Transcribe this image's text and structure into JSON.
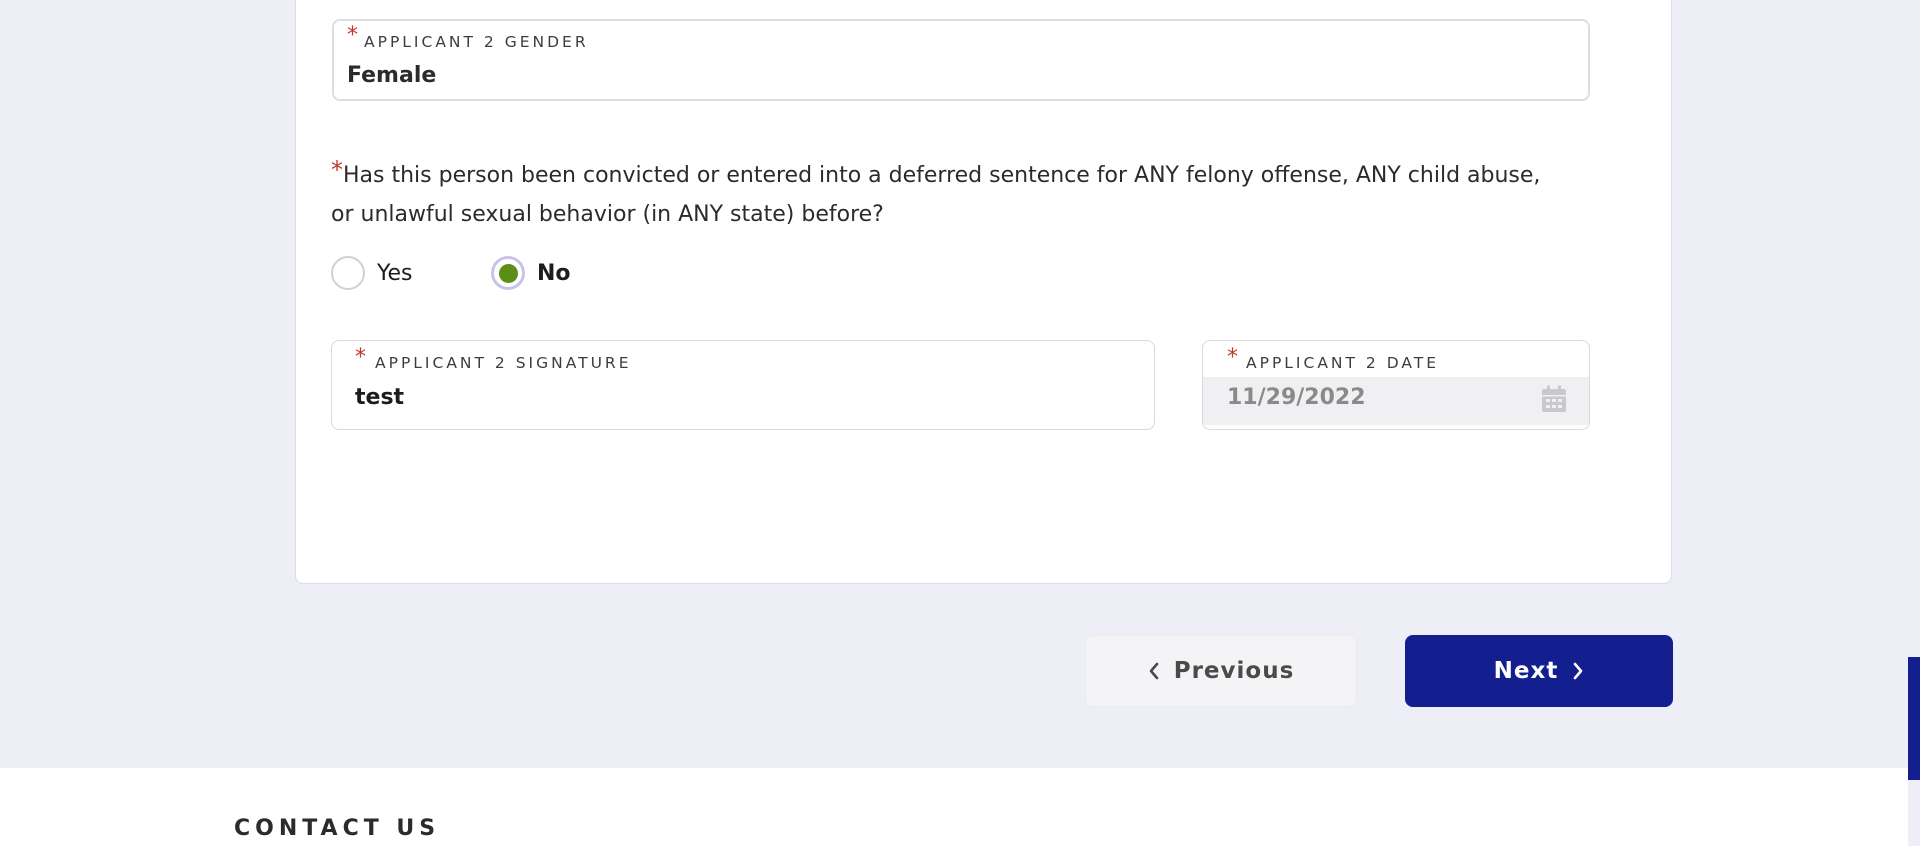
{
  "form": {
    "gender": {
      "label": "APPLICANT 2 GENDER",
      "value": "Female",
      "required_mark": "*"
    },
    "question": {
      "required_mark": "*",
      "line1": "Has this person been convicted or entered into a deferred sentence for ANY felony offense, ANY child abuse,",
      "line2": "or unlawful sexual behavior (in ANY state) before?",
      "options": [
        {
          "label": "Yes",
          "selected": false
        },
        {
          "label": "No",
          "selected": true
        }
      ],
      "selected_color": "#5c8e17"
    },
    "signature": {
      "label": "APPLICANT 2 SIGNATURE",
      "value": "test",
      "required_mark": "*"
    },
    "date": {
      "label": "APPLICANT 2 DATE",
      "value": "11/29/2022",
      "required_mark": "*",
      "icon": "calendar-icon"
    }
  },
  "navigation": {
    "previous_label": "Previous",
    "previous_icon": "chevron-left-icon",
    "next_label": "Next",
    "next_icon": "chevron-right-icon",
    "next_color": "#131e8f"
  },
  "footer": {
    "title": "CONTACT US"
  },
  "colors": {
    "page_background": "#eeeef7",
    "required_mark": "#c0392b",
    "accent": "#131e8f"
  }
}
